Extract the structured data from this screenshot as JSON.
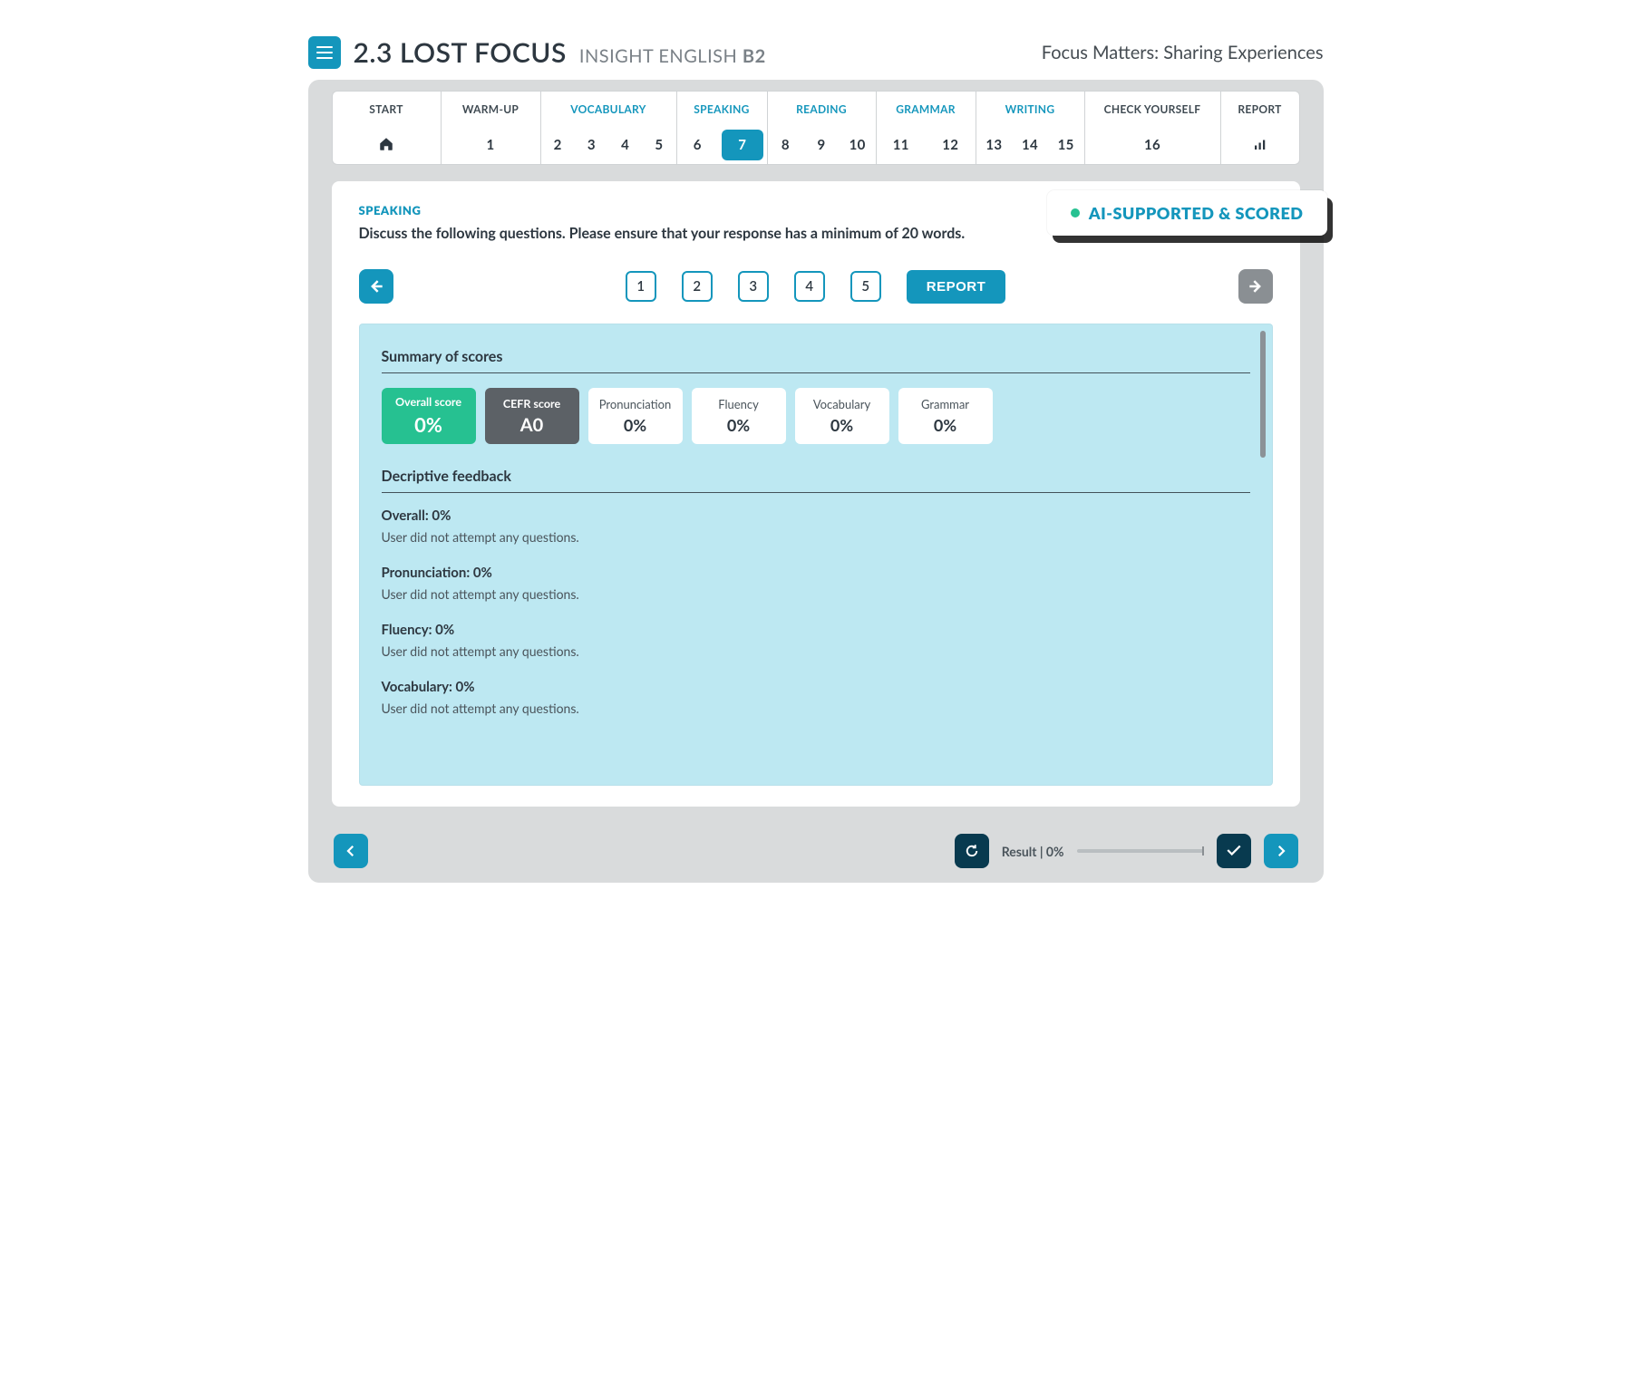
{
  "header": {
    "lesson_code": "2.3",
    "lesson_title": "LOST FOCUS",
    "course": "INSIGHT ENGLISH",
    "level": "B2",
    "tagline": "Focus Matters: Sharing Experiences"
  },
  "stepper": {
    "segments": [
      {
        "key": "start",
        "label": "START",
        "linked": false,
        "width": "w-start",
        "nums": []
      },
      {
        "key": "warm",
        "label": "WARM-UP",
        "linked": false,
        "width": "w-warm",
        "nums": [
          "1"
        ]
      },
      {
        "key": "voc",
        "label": "VOCABULARY",
        "linked": true,
        "width": "w-voc",
        "nums": [
          "2",
          "3",
          "4",
          "5"
        ]
      },
      {
        "key": "spk",
        "label": "SPEAKING",
        "linked": true,
        "width": "w-spk",
        "nums": [
          "6",
          "7"
        ],
        "active": "7"
      },
      {
        "key": "read",
        "label": "READING",
        "linked": true,
        "width": "w-read",
        "nums": [
          "8",
          "9",
          "10"
        ]
      },
      {
        "key": "gram",
        "label": "GRAMMAR",
        "linked": true,
        "width": "w-gram",
        "nums": [
          "11",
          "12"
        ]
      },
      {
        "key": "writ",
        "label": "WRITING",
        "linked": true,
        "width": "w-writ",
        "nums": [
          "13",
          "14",
          "15"
        ]
      },
      {
        "key": "chk",
        "label": "CHECK YOURSELF",
        "linked": false,
        "width": "w-chk",
        "nums": [
          "16"
        ]
      },
      {
        "key": "rep",
        "label": "REPORT",
        "linked": false,
        "width": "w-rep",
        "nums": []
      }
    ]
  },
  "card": {
    "ai_badge": "AI-SUPPORTED & SCORED",
    "section_label": "SPEAKING",
    "prompt": "Discuss the following questions. Please ensure that your response has a minimum of 20 words.",
    "qnums": [
      "1",
      "2",
      "3",
      "4",
      "5"
    ],
    "report_btn": "REPORT"
  },
  "panel": {
    "summary_title": "Summary of scores",
    "scores": [
      {
        "label": "Overall score",
        "value": "0%",
        "style": "green"
      },
      {
        "label": "CEFR score",
        "value": "A0",
        "style": "dark"
      },
      {
        "label": "Pronunciation",
        "value": "0%",
        "style": "white"
      },
      {
        "label": "Fluency",
        "value": "0%",
        "style": "white"
      },
      {
        "label": "Vocabulary",
        "value": "0%",
        "style": "white"
      },
      {
        "label": "Grammar",
        "value": "0%",
        "style": "white"
      }
    ],
    "feedback_title": "Decriptive feedback",
    "feedback": [
      {
        "title": "Overall: 0%",
        "text": "User did not attempt any questions."
      },
      {
        "title": "Pronunciation: 0%",
        "text": "User did not attempt any questions."
      },
      {
        "title": "Fluency: 0%",
        "text": "User did not attempt any questions."
      },
      {
        "title": "Vocabulary: 0%",
        "text": "User did not attempt any questions."
      }
    ]
  },
  "footer": {
    "result_label": "Result | 0%"
  }
}
